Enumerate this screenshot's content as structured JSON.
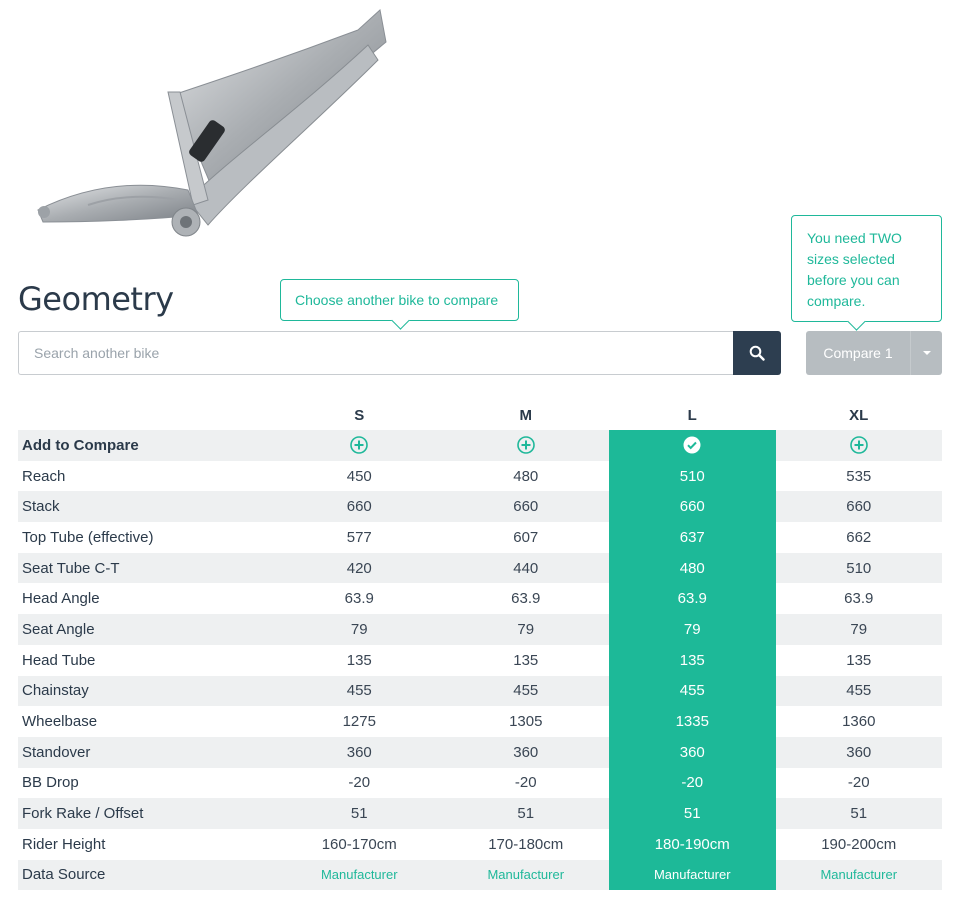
{
  "page": {
    "title": "Geometry"
  },
  "tooltips": {
    "compare_hint": "Choose another bike to compare",
    "two_sizes_hint": "You need TWO sizes selected before you can compare."
  },
  "search": {
    "placeholder": "Search another bike",
    "value": ""
  },
  "compare_button": {
    "label": "Compare 1"
  },
  "colors": {
    "accent": "#1db998",
    "dark": "#2d3e50",
    "disabled": "#b7bdc1"
  },
  "table": {
    "sizes": [
      "S",
      "M",
      "L",
      "XL"
    ],
    "selected_size": "L",
    "add_to_compare_label": "Add to Compare",
    "add_icons": [
      "plus-circle-icon",
      "plus-circle-icon",
      "check-circle-icon",
      "plus-circle-icon"
    ],
    "rows": [
      {
        "label": "Reach",
        "values": [
          "450",
          "480",
          "510",
          "535"
        ]
      },
      {
        "label": "Stack",
        "values": [
          "660",
          "660",
          "660",
          "660"
        ]
      },
      {
        "label": "Top Tube (effective)",
        "values": [
          "577",
          "607",
          "637",
          "662"
        ]
      },
      {
        "label": "Seat Tube C-T",
        "values": [
          "420",
          "440",
          "480",
          "510"
        ]
      },
      {
        "label": "Head Angle",
        "values": [
          "63.9",
          "63.9",
          "63.9",
          "63.9"
        ]
      },
      {
        "label": "Seat Angle",
        "values": [
          "79",
          "79",
          "79",
          "79"
        ]
      },
      {
        "label": "Head Tube",
        "values": [
          "135",
          "135",
          "135",
          "135"
        ]
      },
      {
        "label": "Chainstay",
        "values": [
          "455",
          "455",
          "455",
          "455"
        ]
      },
      {
        "label": "Wheelbase",
        "values": [
          "1275",
          "1305",
          "1335",
          "1360"
        ]
      },
      {
        "label": "Standover",
        "values": [
          "360",
          "360",
          "360",
          "360"
        ]
      },
      {
        "label": "BB Drop",
        "values": [
          "-20",
          "-20",
          "-20",
          "-20"
        ]
      },
      {
        "label": "Fork Rake / Offset",
        "values": [
          "51",
          "51",
          "51",
          "51"
        ]
      },
      {
        "label": "Rider Height",
        "values": [
          "160-170cm",
          "170-180cm",
          "180-190cm",
          "190-200cm"
        ]
      },
      {
        "label": "Data Source",
        "values": [
          "Manufacturer",
          "Manufacturer",
          "Manufacturer",
          "Manufacturer"
        ],
        "link": true
      }
    ]
  }
}
